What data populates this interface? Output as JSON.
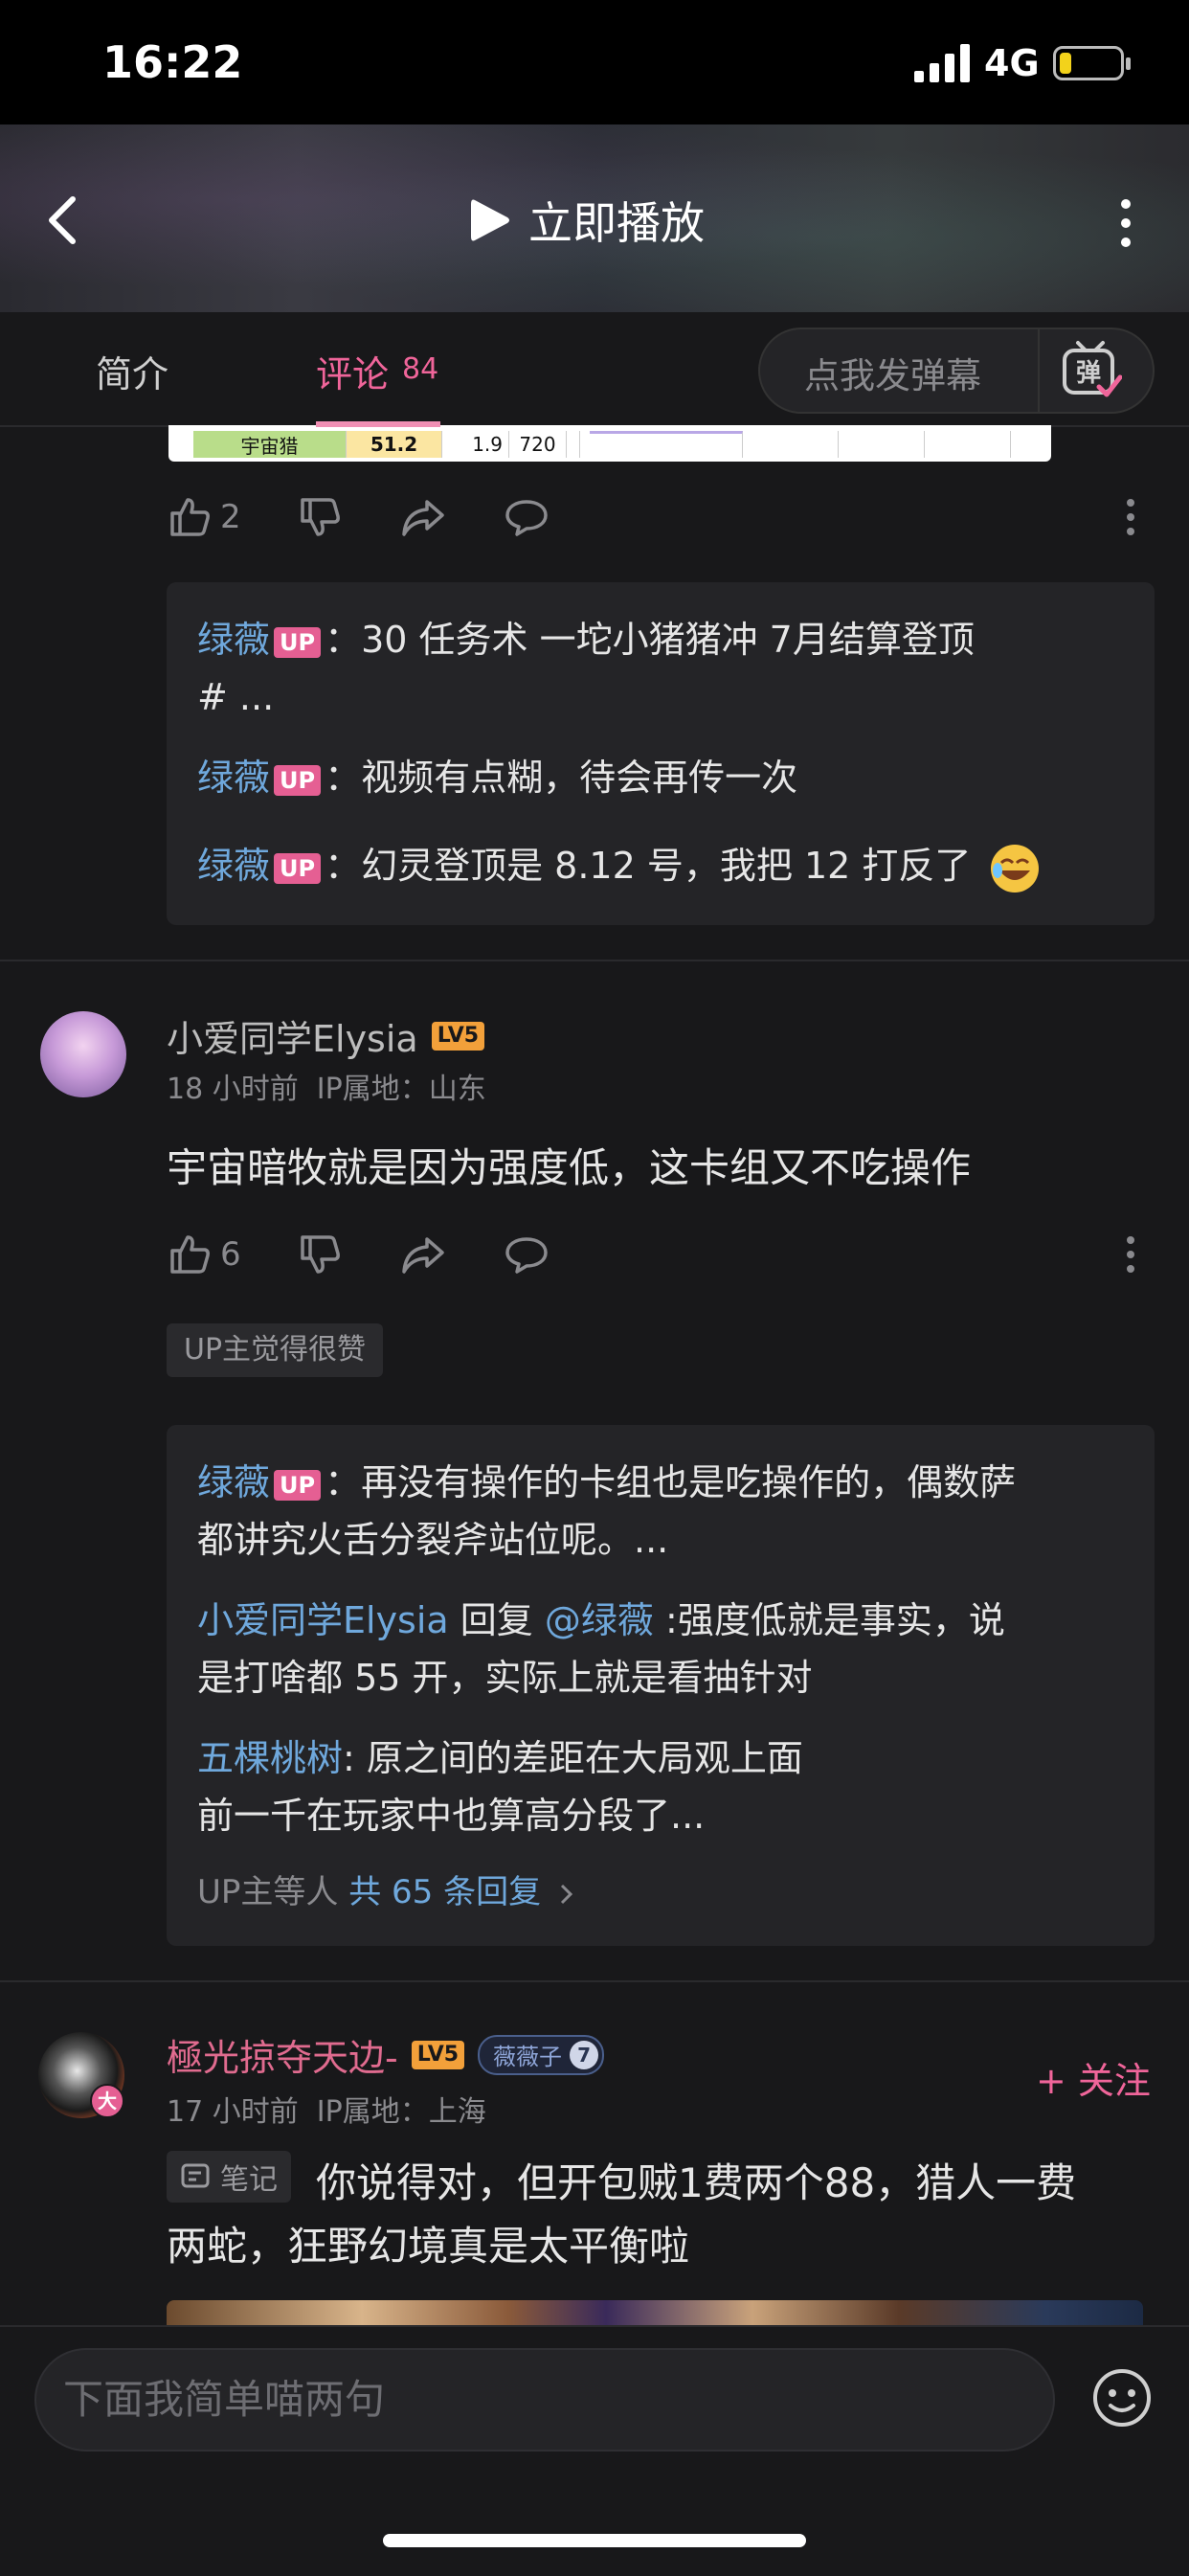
{
  "status": {
    "time": "16:22",
    "network": "4G"
  },
  "header": {
    "play_label": "立即播放"
  },
  "tabs": {
    "intro": "简介",
    "comments": "评论",
    "comment_count": "84",
    "danmu_placeholder": "点我发弹幕",
    "danmu_icon_label": "弹"
  },
  "table_snippet": {
    "name": "宇宙猎",
    "score": "51.2",
    "v1": "1.9",
    "v2": "720"
  },
  "comment0": {
    "likes": "2",
    "replies": [
      {
        "user": "绿薇",
        "badge": "UP",
        "text": "：30 任务术 一坨小猪猪冲 7月结算登顶",
        "text2": "# ..."
      },
      {
        "user": "绿薇",
        "badge": "UP",
        "text": "：视频有点糊，待会再传一次"
      },
      {
        "user": "绿薇",
        "badge": "UP",
        "text": "：幻灵登顶是 8.12 号，我把 12 打反了"
      }
    ]
  },
  "comment1": {
    "username": "小爱同学Elysia",
    "level": "LV5",
    "time": "18 小时前",
    "ip": "IP属地：山东",
    "content": "宇宙暗牧就是因为强度低，这卡组又不吃操作",
    "likes": "6",
    "tag": "UP主觉得很赞",
    "replies": [
      {
        "user": "绿薇",
        "badge": "UP",
        "text": "：再没有操作的卡组也是吃操作的，偶数萨",
        "text2": "都讲究火舌分裂斧站位呢。..."
      },
      {
        "user": "小爱同学Elysia",
        "reply_word": "回复",
        "mention": "@绿薇",
        "text": ":强度低就是事实，说",
        "text2": "是打啥都 55 开，实际上就是看抽针对"
      },
      {
        "user": "五棵桃树",
        "text": ": 原之间的差距在大局观上面",
        "text2": "前一千在玩家中也算高分段了..."
      }
    ],
    "more_prefix": "UP主等人",
    "more_count": "共 65 条回复"
  },
  "comment2": {
    "username": "極光掠夺天边-",
    "level": "LV5",
    "fan_badge": "薇薇子",
    "fan_level": "7",
    "avatar_badge": "大",
    "follow": "+ 关注",
    "time": "17 小时前",
    "ip": "IP属地：上海",
    "note_tag": "笔记",
    "content1": "你说得对，但开包贼1费两个88，猎人一费",
    "content2": "两蛇，狂野幻境真是太平衡啦"
  },
  "bottom": {
    "input_placeholder": "下面我简单喵两句"
  }
}
